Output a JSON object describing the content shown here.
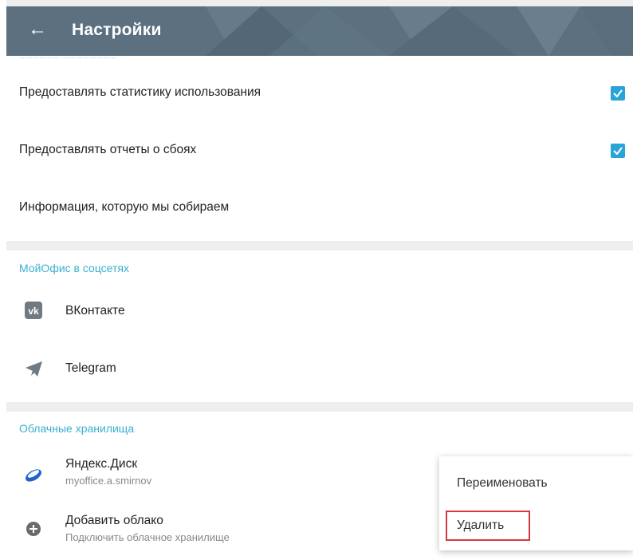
{
  "header": {
    "title": "Настройки",
    "back_icon": "arrow-left-icon"
  },
  "privacy": {
    "items": [
      {
        "label": "Предоставлять статистику использования",
        "checked": true
      },
      {
        "label": "Предоставлять отчеты о сбоях",
        "checked": true
      },
      {
        "label": "Информация, которую мы собираем"
      }
    ]
  },
  "social": {
    "header": "МойОфис в соцсетях",
    "items": [
      {
        "label": "ВКонтакте",
        "icon": "vk-icon"
      },
      {
        "label": "Telegram",
        "icon": "telegram-icon"
      }
    ]
  },
  "cloud": {
    "header": "Облачные хранилища",
    "items": [
      {
        "title": "Яндекс.Диск",
        "subtitle": "myoffice.a.smirnov",
        "icon": "yandex-disk-icon"
      },
      {
        "title": "Добавить облако",
        "subtitle": "Подключить облачное хранилище",
        "icon": "add-circle-icon"
      }
    ]
  },
  "context_menu": {
    "items": [
      "Переименовать",
      "Удалить"
    ],
    "highlighted": "Удалить"
  },
  "colors": {
    "appbar": "#5c7080",
    "accent": "#3ab0d0",
    "checkbox": "#2aa4d8",
    "highlight_border": "#d9363e"
  }
}
